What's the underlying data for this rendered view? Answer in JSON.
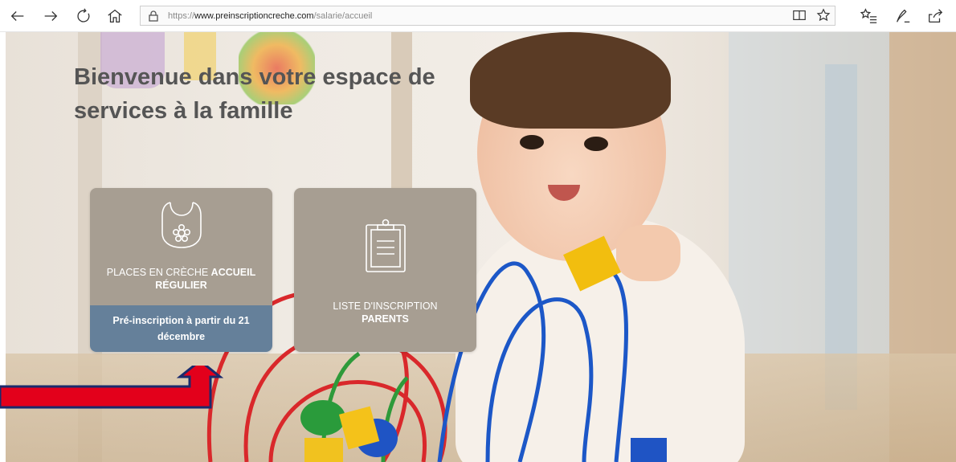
{
  "browser": {
    "url_prefix": "https://",
    "url_domain": "www.preinscriptioncreche.com",
    "url_path": "/salarie/accueil"
  },
  "icons": {
    "back": "back-arrow-icon",
    "forward": "forward-arrow-icon",
    "refresh": "refresh-icon",
    "home": "home-icon",
    "lock": "lock-icon",
    "reading_view": "reading-view-icon",
    "favorite": "star-icon",
    "favorites_bar": "favorites-list-icon",
    "notes": "pen-icon",
    "share": "share-icon"
  },
  "page": {
    "heading_line1": "Bienvenue dans votre espace de",
    "heading_line2": "services à la famille"
  },
  "tiles": [
    {
      "label_plain": "PLACES EN CRÈCHE ",
      "label_bold_1": "ACCUEIL",
      "label_bold_2": "RÉGULIER",
      "footer": "Pré-inscription à partir du 21 décembre",
      "icon": "bib-icon"
    },
    {
      "label_plain": "LISTE D'INSCRIPTION",
      "label_bold_1": "PARENTS",
      "icon": "clipboard-icon"
    }
  ],
  "colors": {
    "tile_bg": "#a79e92",
    "tile_footer": "#65809a",
    "heading": "#555555",
    "arrow": "#e3001b"
  }
}
